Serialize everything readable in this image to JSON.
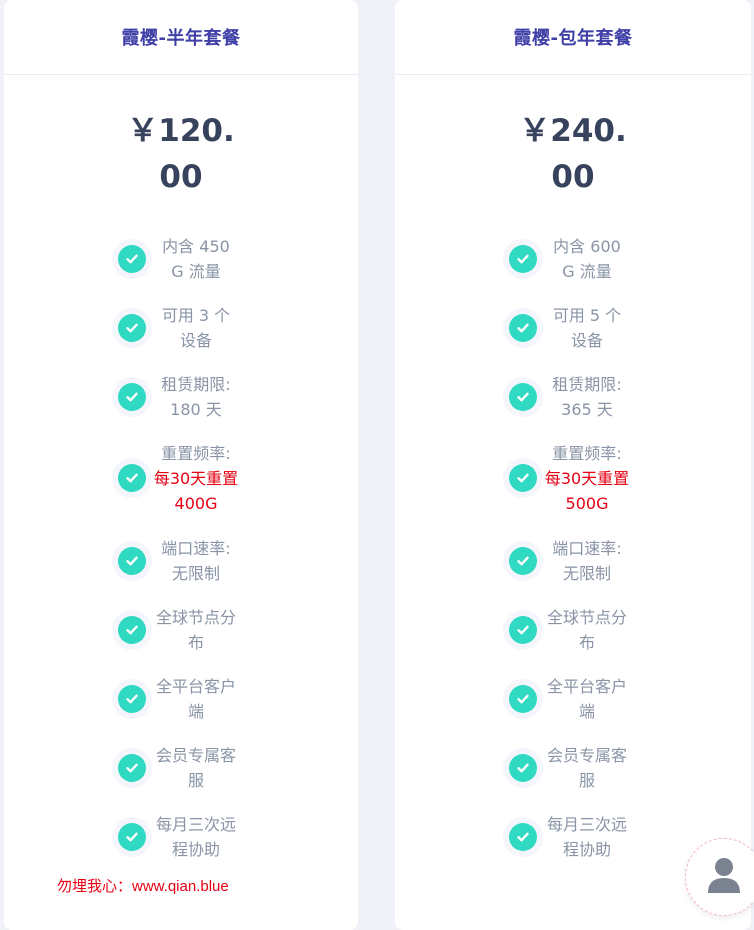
{
  "plans": [
    {
      "title": "霞樱-半年套餐",
      "price": "￥120.00",
      "features": [
        {
          "text": "内含 450 G 流量"
        },
        {
          "text": "可用 3 个设备"
        },
        {
          "text": "租赁期限: 180 天"
        },
        {
          "label": "重置频率:",
          "highlight": "每30天重置400G"
        },
        {
          "text": "端口速率: 无限制"
        },
        {
          "text": "全球节点分布"
        },
        {
          "text": "全平台客户端"
        },
        {
          "text": "会员专属客服"
        },
        {
          "text": "每月三次远程协助"
        }
      ]
    },
    {
      "title": "霞樱-包年套餐",
      "price": "￥240.00",
      "features": [
        {
          "text": "内含 600 G 流量"
        },
        {
          "text": "可用 5 个设备"
        },
        {
          "text": "租赁期限: 365 天"
        },
        {
          "label": "重置频率:",
          "highlight": "每30天重置500G"
        },
        {
          "text": "端口速率: 无限制"
        },
        {
          "text": "全球节点分布"
        },
        {
          "text": "全平台客户端"
        },
        {
          "text": "会员专属客服"
        },
        {
          "text": "每月三次远程协助"
        }
      ]
    }
  ],
  "watermark": "勿埋我心：www.qian.blue",
  "icons": {
    "check": "check-circle-icon",
    "support": "user-avatar-icon"
  },
  "colors": {
    "accent": "#2fd9c2",
    "title": "#3f3fa8",
    "highlight": "#e60012"
  }
}
